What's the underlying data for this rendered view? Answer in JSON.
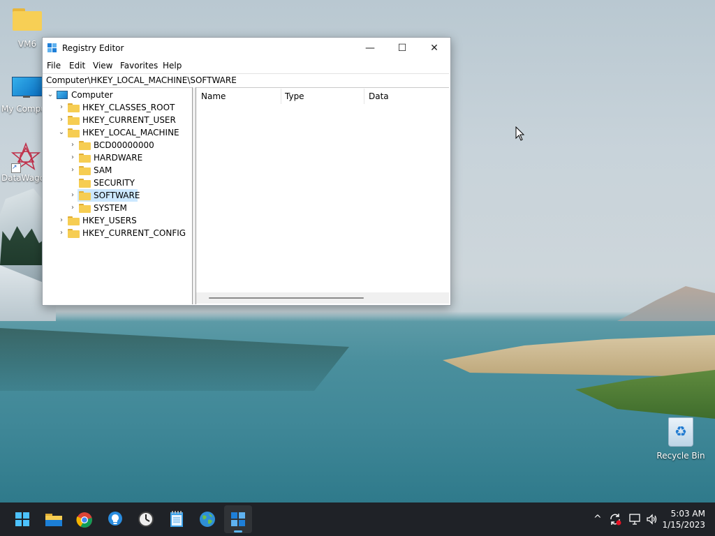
{
  "desktop": {
    "icons": [
      {
        "label": "VM6",
        "icon": "folder-icon"
      },
      {
        "label": "My Compu",
        "icon": "computer-icon"
      },
      {
        "label": "DataWago",
        "icon": "datawagon-icon"
      },
      {
        "label": "Recycle Bin",
        "icon": "recycle-bin-icon"
      }
    ]
  },
  "window": {
    "title": "Registry Editor",
    "controls": {
      "minimize": "—",
      "maximize": "☐",
      "close": "✕"
    },
    "menu": [
      "File",
      "Edit",
      "View",
      "Favorites",
      "Help"
    ],
    "address": "Computer\\HKEY_LOCAL_MACHINE\\SOFTWARE",
    "tree": {
      "root": "Computer",
      "items": [
        {
          "label": "HKEY_CLASSES_ROOT",
          "level": 1,
          "expanded": false
        },
        {
          "label": "HKEY_CURRENT_USER",
          "level": 1,
          "expanded": false
        },
        {
          "label": "HKEY_LOCAL_MACHINE",
          "level": 1,
          "expanded": true
        },
        {
          "label": "BCD00000000",
          "level": 2,
          "expanded": false
        },
        {
          "label": "HARDWARE",
          "level": 2,
          "expanded": false
        },
        {
          "label": "SAM",
          "level": 2,
          "expanded": false
        },
        {
          "label": "SECURITY",
          "level": 2,
          "expanded": false,
          "no_chevron": true
        },
        {
          "label": "SOFTWARE",
          "level": 2,
          "expanded": false,
          "selected": true
        },
        {
          "label": "SYSTEM",
          "level": 2,
          "expanded": false
        },
        {
          "label": "HKEY_USERS",
          "level": 1,
          "expanded": false
        },
        {
          "label": "HKEY_CURRENT_CONFIG",
          "level": 1,
          "expanded": false
        }
      ]
    },
    "columns": [
      "Name",
      "Type",
      "Data"
    ],
    "colors": {
      "selected": "#cce8ff",
      "folder": "#f6cd52"
    }
  },
  "taskbar": {
    "apps": [
      {
        "name": "start-button",
        "icon": "windows-icon"
      },
      {
        "name": "file-explorer",
        "icon": "folder-icon"
      },
      {
        "name": "chrome",
        "icon": "chrome-icon"
      },
      {
        "name": "tips",
        "icon": "lightbulb-icon"
      },
      {
        "name": "clock-app",
        "icon": "clock-icon"
      },
      {
        "name": "notepad",
        "icon": "notepad-icon"
      },
      {
        "name": "maps",
        "icon": "globe-icon"
      },
      {
        "name": "registry-editor",
        "icon": "regedit-icon",
        "active": true
      }
    ],
    "tray": {
      "chevron": "^",
      "time": "5:03 AM",
      "date": "1/15/2023"
    }
  }
}
